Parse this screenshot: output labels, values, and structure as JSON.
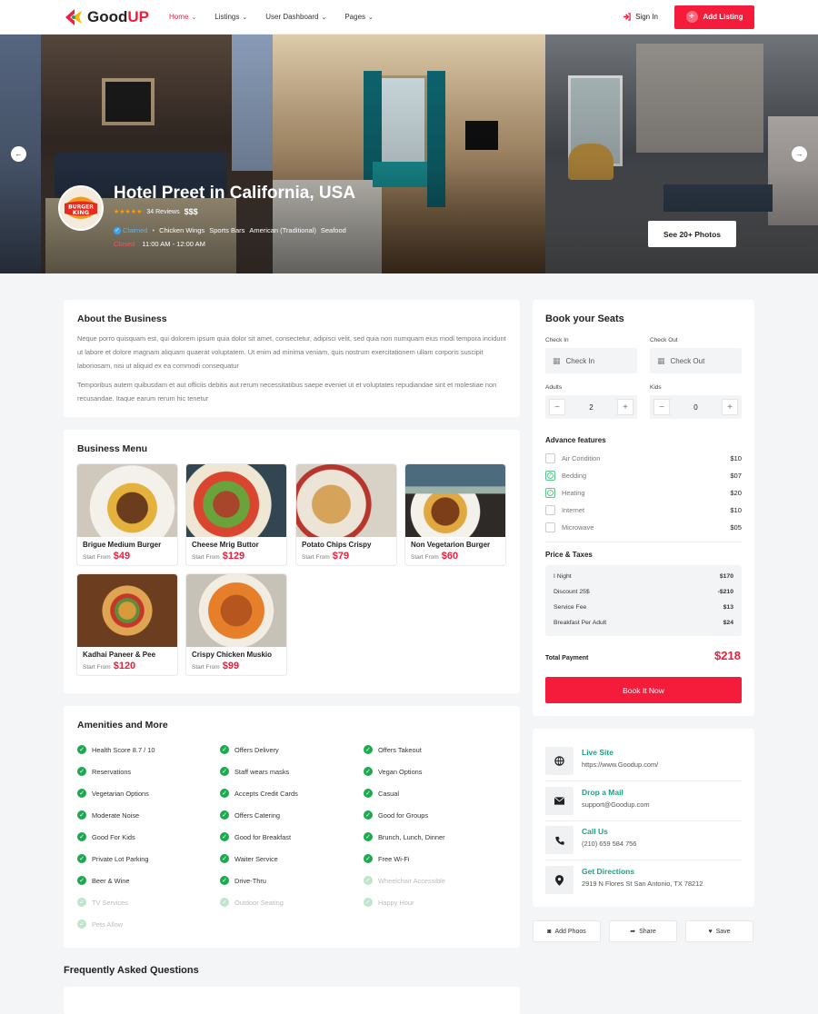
{
  "header": {
    "logo_text_1": "Good",
    "logo_text_2": "UP",
    "nav": [
      {
        "label": "Home",
        "active": true
      },
      {
        "label": "Listings",
        "active": false
      },
      {
        "label": "User Dashboard",
        "active": false
      },
      {
        "label": "Pages",
        "active": false
      }
    ],
    "signin_label": "Sign In",
    "add_listing_label": "Add Listing"
  },
  "hero": {
    "logo_text_1": "BURGER",
    "logo_text_2": "KING",
    "title": "Hotel Preet in California, USA",
    "stars": "★★★★★",
    "reviews": "34 Reviews",
    "price_level": "$$$",
    "claimed_label": "Claimed",
    "categories": [
      "Chicken Wings",
      "Sports Bars",
      "American (Traditional)",
      "Seafood"
    ],
    "status": "Closed",
    "hours": "11:00 AM - 12:00 AM",
    "photos_button": "See 20+ Photos",
    "prev_arrow": "←",
    "next_arrow": "→"
  },
  "about": {
    "title": "About the Business",
    "p1": "Neque porro quisquam est, qui dolorem ipsum quia dolor sit amet, consectetur, adipisci velit, sed quia non numquam eius modi tempora incidunt ut labore et dolore magnam aliquam quaerat voluptatem. Ut enim ad minima veniam, quis nostrum exercitationem ullam corporis suscipit laboriosam, nisi ut aliquid ex ea commodi consequatur",
    "p2": "Temporibus autem quibusdam et aut officiis debitis aut rerum necessitatibus saepe eveniet ut et voluptates repudiandae sint et molestiae non recusandae. Itaque earum rerum hic tenetur"
  },
  "menu": {
    "title": "Business Menu",
    "start_label": "Start From",
    "items": [
      {
        "name": "Brigue Medium Burger",
        "price": "$49"
      },
      {
        "name": "Cheese Mrig Buttor",
        "price": "$129"
      },
      {
        "name": "Potato Chips Crispy",
        "price": "$79"
      },
      {
        "name": "Non Vegetarion Burger",
        "price": "$60"
      },
      {
        "name": "Kadhai Paneer & Pee",
        "price": "$120"
      },
      {
        "name": "Crispy Chicken Muskio",
        "price": "$99"
      }
    ]
  },
  "amenities": {
    "title": "Amenities and More",
    "items": [
      {
        "label": "Health Score 8.7 / 10",
        "available": true
      },
      {
        "label": "Offers Delivery",
        "available": true
      },
      {
        "label": "Offers Takeout",
        "available": true
      },
      {
        "label": "Reservations",
        "available": true
      },
      {
        "label": "Staff wears masks",
        "available": true
      },
      {
        "label": "Vegan Options",
        "available": true
      },
      {
        "label": "Vegetarian Options",
        "available": true
      },
      {
        "label": "Accepts Credit Cards",
        "available": true
      },
      {
        "label": "Casual",
        "available": true
      },
      {
        "label": "Moderate Noise",
        "available": true
      },
      {
        "label": "Offers Catering",
        "available": true
      },
      {
        "label": "Good for Groups",
        "available": true
      },
      {
        "label": "Good For Kids",
        "available": true
      },
      {
        "label": "Good for Breakfast",
        "available": true
      },
      {
        "label": "Brunch, Lunch, Dinner",
        "available": true
      },
      {
        "label": "Private Lot Parking",
        "available": true
      },
      {
        "label": "Waiter Service",
        "available": true
      },
      {
        "label": "Free Wi-Fi",
        "available": true
      },
      {
        "label": "Beer & Wine",
        "available": true
      },
      {
        "label": "Drive-Thru",
        "available": true
      },
      {
        "label": "Wheelchair Accessible",
        "available": false
      },
      {
        "label": "TV Services",
        "available": false
      },
      {
        "label": "Outdoor Seating",
        "available": false
      },
      {
        "label": "Happy Hour",
        "available": false
      },
      {
        "label": "Pets Allow",
        "available": false
      }
    ]
  },
  "faq": {
    "title": "Frequently Asked Questions"
  },
  "booking": {
    "title": "Book your Seats",
    "checkin_label": "Check In",
    "checkin_placeholder": "Check In",
    "checkout_label": "Check Out",
    "checkout_placeholder": "Check Out",
    "adults_label": "Adults",
    "adults_value": "2",
    "kids_label": "Kids",
    "kids_value": "0",
    "minus": "−",
    "plus": "+",
    "features_title": "Advance features",
    "features": [
      {
        "label": "Air Condition",
        "price": "$10",
        "checked": false
      },
      {
        "label": "Bedding",
        "price": "$07",
        "checked": true
      },
      {
        "label": "Heating",
        "price": "$20",
        "checked": true
      },
      {
        "label": "Internet",
        "price": "$10",
        "checked": false
      },
      {
        "label": "Microwave",
        "price": "$05",
        "checked": false
      }
    ],
    "taxes_title": "Price & Taxes",
    "taxes": [
      {
        "label": "I Night",
        "value": "$170"
      },
      {
        "label": "Discount 25$",
        "value": "-$210"
      },
      {
        "label": "Service Fee",
        "value": "$13"
      },
      {
        "label": "Breakfast Per Adult",
        "value": "$24"
      }
    ],
    "total_label": "Total Payment",
    "total_value": "$218",
    "book_button": "Book It Now"
  },
  "contacts": [
    {
      "icon": "globe-icon",
      "title": "Live Site",
      "sub": "https://www.Goodup.com/"
    },
    {
      "icon": "envelope-icon",
      "title": "Drop a Mail",
      "sub": "support@Goodup.com"
    },
    {
      "icon": "phone-icon",
      "title": "Call Us",
      "sub": "(210) 659 584 756"
    },
    {
      "icon": "map-pin-icon",
      "title": "Get Directions",
      "sub": "2919 N Flores St San Antonio, TX 78212"
    }
  ],
  "actions": {
    "add_photos": "Add Phoos",
    "share": "Share",
    "save": "Save"
  },
  "colors": {
    "brand": "#f41b3b",
    "accent_green": "#1ba385",
    "check_green": "#1fa94f"
  }
}
